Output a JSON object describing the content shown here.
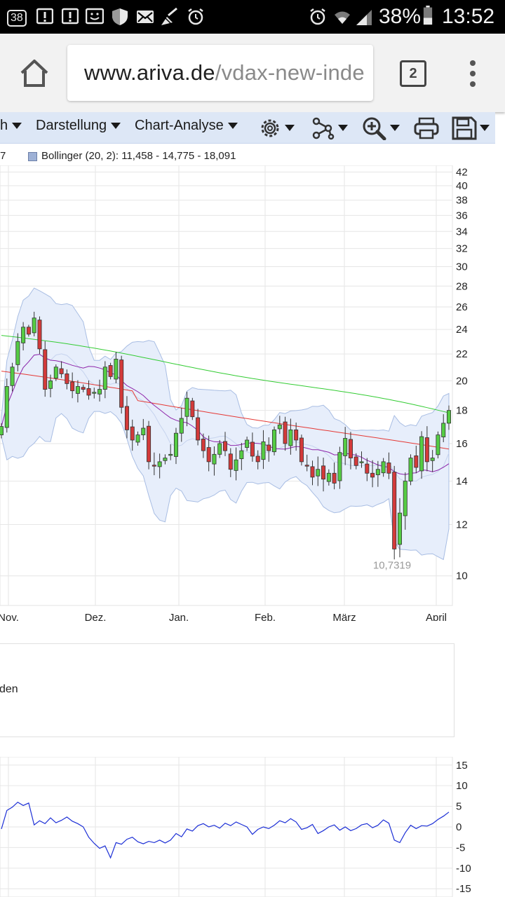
{
  "status_bar": {
    "notif_badge": "38",
    "battery": "38%",
    "time": "13:52"
  },
  "browser": {
    "url_host": "www.ariva.de",
    "url_path": "/vdax-new-inde",
    "tab_count": "2"
  },
  "toolbar": {
    "partial_item": "h",
    "darstellung": "Darstellung",
    "chart_analyse": "Chart-Analyse"
  },
  "legend": {
    "prefix": "7",
    "bollinger": "Bollinger (20, 2): 11,458 - 14,775 - 18,091"
  },
  "panel2": {
    "partial_text": "den"
  },
  "chart_data": [
    {
      "type": "candlestick",
      "instrument": "VDAX-NEW",
      "x_tick_labels": [
        "Nov.",
        "Dez.",
        "Jan.",
        "Feb.",
        "März",
        "April"
      ],
      "y_tick_labels": [
        "42",
        "40",
        "38",
        "36",
        "34",
        "32",
        "30",
        "28",
        "26",
        "24",
        "22",
        "20",
        "18",
        "16",
        "14",
        "12",
        "10"
      ],
      "ylim": [
        9,
        43
      ],
      "y_scale": "log",
      "annotation": "10,7319",
      "annotation_value": 10.7319,
      "series": [
        {
          "name": "Bollinger (20, 2)",
          "kind": "band"
        },
        {
          "kind": "moving-average",
          "color": "#e53935"
        },
        {
          "kind": "moving-average",
          "color": "#33cc33"
        },
        {
          "kind": "moving-average",
          "color": "#8e24aa"
        }
      ],
      "closes": [
        17.0,
        19.6,
        21.0,
        23.0,
        24.2,
        23.6,
        25.0,
        22.4,
        19.4,
        20.0,
        21.0,
        20.5,
        19.8,
        19.3,
        19.6,
        19.4,
        19.0,
        19.2,
        19.4,
        21.0,
        20.3,
        21.6,
        18.2,
        16.8,
        16.2,
        16.5,
        16.9,
        15.0,
        14.8,
        15.0,
        15.2,
        15.4,
        16.6,
        17.5,
        18.8,
        17.6,
        16.2,
        15.6,
        15.0,
        15.4,
        16.0,
        15.6,
        14.6,
        15.1,
        15.6,
        16.2,
        15.3,
        15.0,
        16.1,
        15.6,
        16.8,
        17.1,
        16.0,
        16.8,
        16.2,
        15.0,
        14.8,
        14.2,
        14.6,
        14.1,
        14.4,
        13.9,
        15.5,
        16.3,
        15.2,
        14.8,
        15.0,
        14.4,
        14.2,
        14.6,
        15.0,
        14.4,
        11.0,
        12.5,
        14.0,
        15.2,
        14.7,
        16.4,
        15.0,
        15.2,
        16.5,
        17.2,
        18.0
      ],
      "bollinger_lower_value": 11.458,
      "bollinger_mid_value": 14.775,
      "bollinger_upper_value": 18.091
    },
    {
      "type": "line",
      "y_tick_labels": [
        "15",
        "10",
        "5",
        "0",
        "-5",
        "-10",
        "-15"
      ],
      "ylim": [
        -17,
        17
      ],
      "series": [
        {
          "color": "#1c2fd6",
          "values": [
            -0.5,
            4.0,
            4.8,
            6.0,
            5.2,
            5.8,
            0.5,
            1.5,
            0.8,
            2.2,
            1.0,
            1.6,
            2.4,
            1.4,
            0.8,
            0.0,
            -2.5,
            -4.0,
            -5.2,
            -4.6,
            -7.5,
            -3.8,
            -4.2,
            -3.0,
            -2.5,
            -3.6,
            -4.1,
            -3.5,
            -3.8,
            -3.2,
            -3.9,
            -3.2,
            -1.6,
            -2.4,
            -0.5,
            -1.0,
            0.3,
            0.8,
            0.0,
            0.4,
            -0.3,
            0.9,
            0.3,
            1.2,
            0.6,
            0.0,
            -1.8,
            -0.6,
            0.0,
            -0.4,
            0.4,
            1.5,
            1.0,
            2.0,
            1.2,
            -0.6,
            -0.2,
            0.6,
            -1.6,
            -0.9,
            0.0,
            0.5,
            -0.8,
            0.0,
            -0.9,
            -0.4,
            0.5,
            0.8,
            -0.2,
            0.4,
            1.7,
            0.9,
            -3.2,
            -3.8,
            -1.4,
            0.4,
            -0.4,
            0.3,
            0.2,
            0.8,
            1.8,
            2.6,
            3.6
          ]
        }
      ]
    }
  ]
}
